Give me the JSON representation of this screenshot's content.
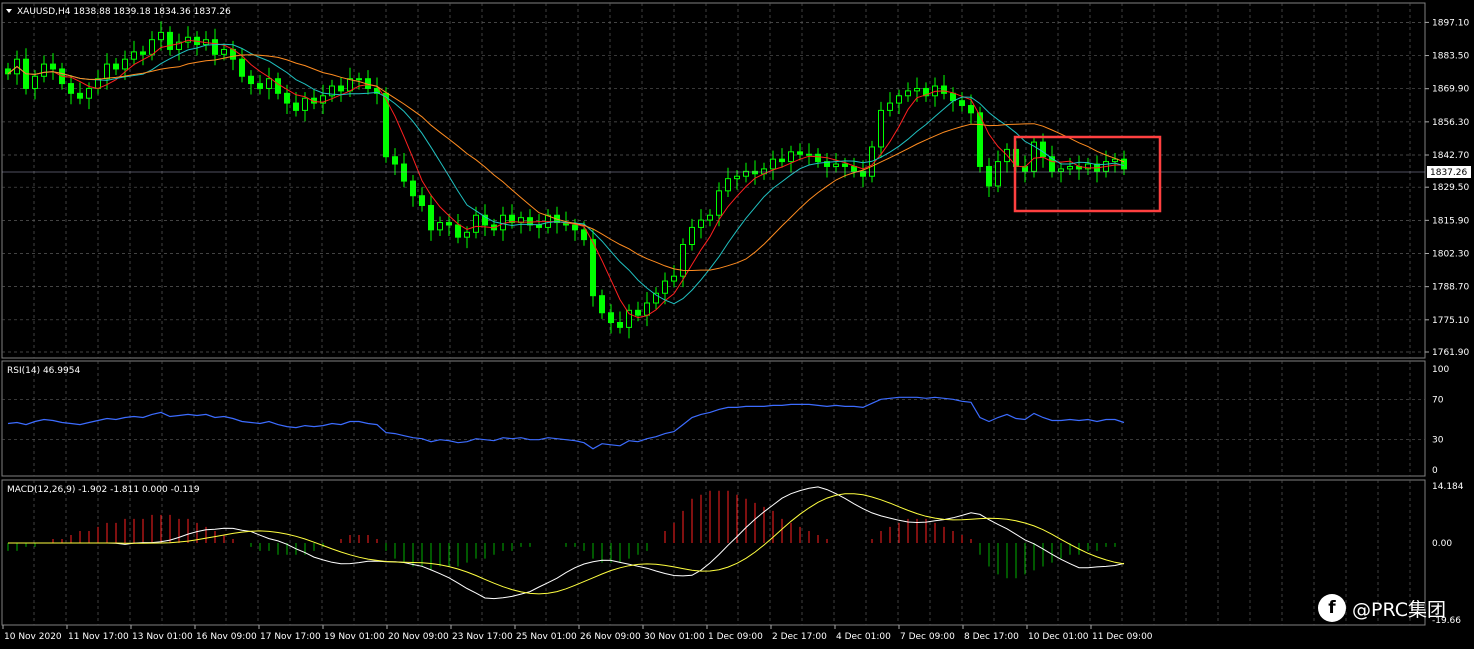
{
  "header": {
    "symbol_line": "XAUUSD,H4  1838.88 1839.18 1834.36 1837.26",
    "current_price_label": "1837.26"
  },
  "price_axis": {
    "labels": [
      "1897.10",
      "1883.50",
      "1869.90",
      "1856.30",
      "1842.70",
      "1829.50",
      "1815.90",
      "1802.30",
      "1788.70",
      "1775.10",
      "1761.90"
    ]
  },
  "rsi": {
    "label": "RSI(14) 46.9954",
    "axis_labels": [
      "100",
      "70",
      "30",
      "0"
    ]
  },
  "macd": {
    "label": "MACD(12,26,9) -1.902 -1.811 0.000 -0.119",
    "axis_labels": [
      "14.184",
      "0.00",
      "-19.66"
    ]
  },
  "time_axis": {
    "labels": [
      "10 Nov 2020",
      "11 Nov 17:00",
      "13 Nov 01:00",
      "16 Nov 09:00",
      "17 Nov 17:00",
      "19 Nov 01:00",
      "20 Nov 09:00",
      "23 Nov 17:00",
      "25 Nov 01:00",
      "26 Nov 09:00",
      "30 Nov 01:00",
      "1 Dec 09:00",
      "2 Dec 17:00",
      "4 Dec 01:00",
      "7 Dec 09:00",
      "8 Dec 17:00",
      "10 Dec 01:00",
      "11 Dec 09:00"
    ]
  },
  "watermark": {
    "text": "@PRC集团",
    "logo_glyph": "f"
  },
  "colors": {
    "candle": "#00ff00",
    "ma_fast": "#ff2020",
    "ma_mid": "#20c0c0",
    "ma_slow": "#ff8c20",
    "rsi_line": "#3c6cff",
    "macd_main": "#ffffff",
    "macd_signal": "#ffff40",
    "hist_pos": "#ff2020",
    "hist_neg": "#00b000",
    "highlight_box": "#ff4040"
  },
  "chart_data": {
    "type": "candlestick",
    "ylim": [
      1761.9,
      1903.0
    ],
    "closes": [
      1876,
      1882,
      1870,
      1875,
      1880,
      1878,
      1872,
      1868,
      1866,
      1870,
      1874,
      1880,
      1878,
      1882,
      1885,
      1884,
      1890,
      1893,
      1886,
      1889,
      1891,
      1888,
      1890,
      1884,
      1886,
      1882,
      1875,
      1872,
      1870,
      1874,
      1868,
      1864,
      1861,
      1866,
      1864,
      1867,
      1871,
      1869,
      1874,
      1874,
      1870,
      1868,
      1842,
      1839,
      1832,
      1826,
      1822,
      1812,
      1815,
      1814,
      1809,
      1811,
      1818,
      1814,
      1812,
      1818,
      1815,
      1817,
      1814,
      1813,
      1818,
      1815,
      1814,
      1812,
      1808,
      1785,
      1778,
      1774,
      1772,
      1779,
      1777,
      1782,
      1786,
      1791,
      1793,
      1806,
      1813,
      1816,
      1818,
      1828,
      1833,
      1834,
      1836,
      1835,
      1837,
      1841,
      1840,
      1844,
      1843,
      1843,
      1840,
      1838,
      1839,
      1838,
      1836,
      1834,
      1846,
      1861,
      1864,
      1867,
      1869,
      1870,
      1867,
      1871,
      1868,
      1865,
      1863,
      1860,
      1838,
      1830,
      1840,
      1845,
      1838,
      1836,
      1848,
      1842,
      1836,
      1837,
      1838,
      1837,
      1839,
      1836,
      1840,
      1841,
      1837
    ],
    "ma_fast": [],
    "rsi_values": [
      46,
      47,
      45,
      48,
      50,
      49,
      47,
      46,
      45,
      47,
      49,
      51,
      50,
      52,
      53,
      52,
      55,
      57,
      53,
      54,
      55,
      54,
      55,
      52,
      53,
      51,
      48,
      47,
      46,
      48,
      45,
      43,
      42,
      44,
      43,
      44,
      46,
      45,
      48,
      48,
      46,
      45,
      37,
      36,
      34,
      32,
      31,
      28,
      30,
      29,
      27,
      28,
      31,
      30,
      29,
      32,
      31,
      32,
      30,
      30,
      32,
      31,
      30,
      29,
      27,
      21,
      26,
      25,
      24,
      29,
      28,
      31,
      33,
      36,
      38,
      45,
      52,
      55,
      57,
      60,
      62,
      62,
      63,
      63,
      63,
      64,
      64,
      65,
      65,
      65,
      64,
      63,
      64,
      63,
      63,
      62,
      66,
      70,
      71,
      72,
      72,
      72,
      71,
      72,
      71,
      70,
      68,
      67,
      52,
      48,
      52,
      55,
      51,
      50,
      56,
      52,
      49,
      49,
      50,
      49,
      50,
      48,
      50,
      50,
      47
    ],
    "macd_hist": [
      -2,
      -2,
      -1,
      -1,
      0,
      1,
      1,
      2,
      3,
      3,
      4,
      5,
      5,
      6,
      6,
      6,
      7,
      7,
      7,
      6,
      6,
      5,
      4,
      3,
      2,
      1,
      0,
      -1,
      -2,
      -2,
      -3,
      -3,
      -3,
      -3,
      -2,
      -1,
      0,
      1,
      2,
      2,
      2,
      1,
      -2,
      -4,
      -5,
      -6,
      -6,
      -7,
      -6,
      -6,
      -6,
      -5,
      -4,
      -4,
      -3,
      -2,
      -2,
      -1,
      -1,
      0,
      0,
      0,
      -1,
      -1,
      -2,
      -4,
      -5,
      -5,
      -5,
      -4,
      -3,
      -2,
      0,
      3,
      5,
      8,
      11,
      12,
      13,
      13,
      13,
      12,
      11,
      10,
      9,
      8,
      6,
      5,
      4,
      3,
      2,
      1,
      0,
      0,
      0,
      0,
      1,
      3,
      4,
      5,
      6,
      6,
      6,
      5,
      4,
      3,
      2,
      1,
      -3,
      -6,
      -8,
      -9,
      -9,
      -8,
      -7,
      -6,
      -5,
      -4,
      -3,
      -3,
      -2,
      -2,
      -1,
      -1,
      0
    ]
  }
}
